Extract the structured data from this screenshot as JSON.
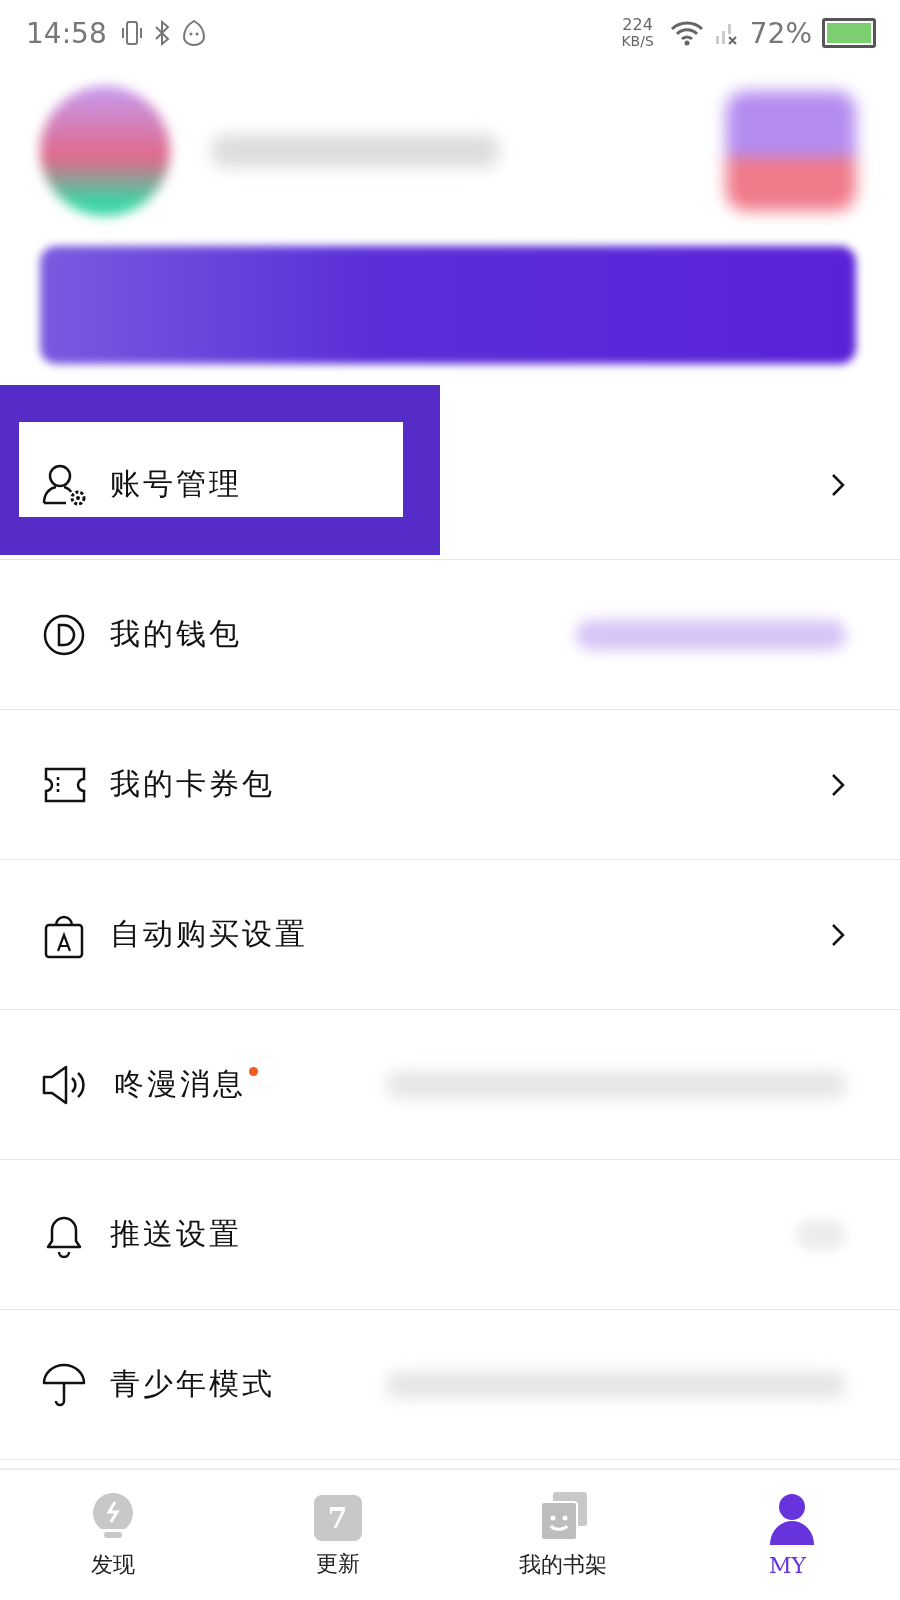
{
  "status_bar": {
    "time": "14:58",
    "speed_value": "224",
    "speed_unit": "KB/S",
    "battery": "72%"
  },
  "menu": [
    {
      "label": "账号管理",
      "kind": "chevron",
      "dot": false,
      "highlighted": true
    },
    {
      "label": "我的钱包",
      "kind": "balance",
      "dot": false,
      "highlighted": false
    },
    {
      "label": "我的卡券包",
      "kind": "chevron",
      "dot": false,
      "highlighted": false
    },
    {
      "label": "自动购买设置",
      "kind": "chevron",
      "dot": false,
      "highlighted": false
    },
    {
      "label": "咚漫消息",
      "kind": "message",
      "dot": true,
      "highlighted": false
    },
    {
      "label": "推送设置",
      "kind": "toggle",
      "dot": false,
      "highlighted": false
    },
    {
      "label": "青少年模式",
      "kind": "message",
      "dot": false,
      "highlighted": false
    }
  ],
  "tabs": [
    {
      "label": "发现",
      "selected": false
    },
    {
      "label": "更新",
      "icon_text": "7",
      "selected": false
    },
    {
      "label": "我的书架",
      "selected": false
    },
    {
      "label": "MY",
      "selected": true
    }
  ]
}
